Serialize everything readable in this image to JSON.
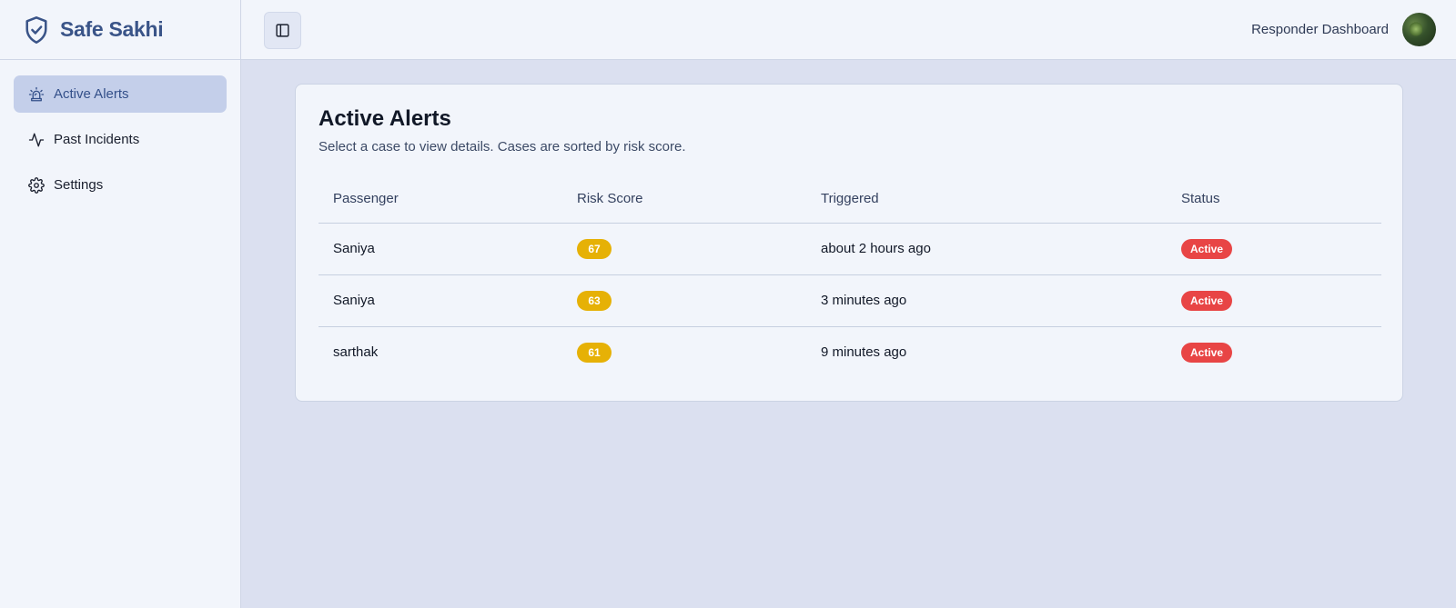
{
  "brand": {
    "name": "Safe Sakhi"
  },
  "sidebar": {
    "items": [
      {
        "label": "Active Alerts",
        "icon": "siren-icon",
        "active": true
      },
      {
        "label": "Past Incidents",
        "icon": "activity-icon",
        "active": false
      },
      {
        "label": "Settings",
        "icon": "gear-icon",
        "active": false
      }
    ]
  },
  "header": {
    "role_label": "Responder Dashboard",
    "toggle_icon": "sidebar-toggle-icon"
  },
  "main": {
    "title": "Active Alerts",
    "subtitle": "Select a case to view details. Cases are sorted by risk score.",
    "table": {
      "columns": [
        "Passenger",
        "Risk Score",
        "Triggered",
        "Status"
      ],
      "rows": [
        {
          "passenger": "Saniya",
          "risk_score": "67",
          "triggered": "about 2 hours ago",
          "status": "Active"
        },
        {
          "passenger": "Saniya",
          "risk_score": "63",
          "triggered": "3 minutes ago",
          "status": "Active"
        },
        {
          "passenger": "sarthak",
          "risk_score": "61",
          "triggered": "9 minutes ago",
          "status": "Active"
        }
      ]
    }
  },
  "colors": {
    "brand": "#3a5488",
    "active_nav_bg": "#c4cfea",
    "risk_badge": "#e6b106",
    "status_active": "#e84545",
    "content_bg": "#dbe0f0"
  }
}
